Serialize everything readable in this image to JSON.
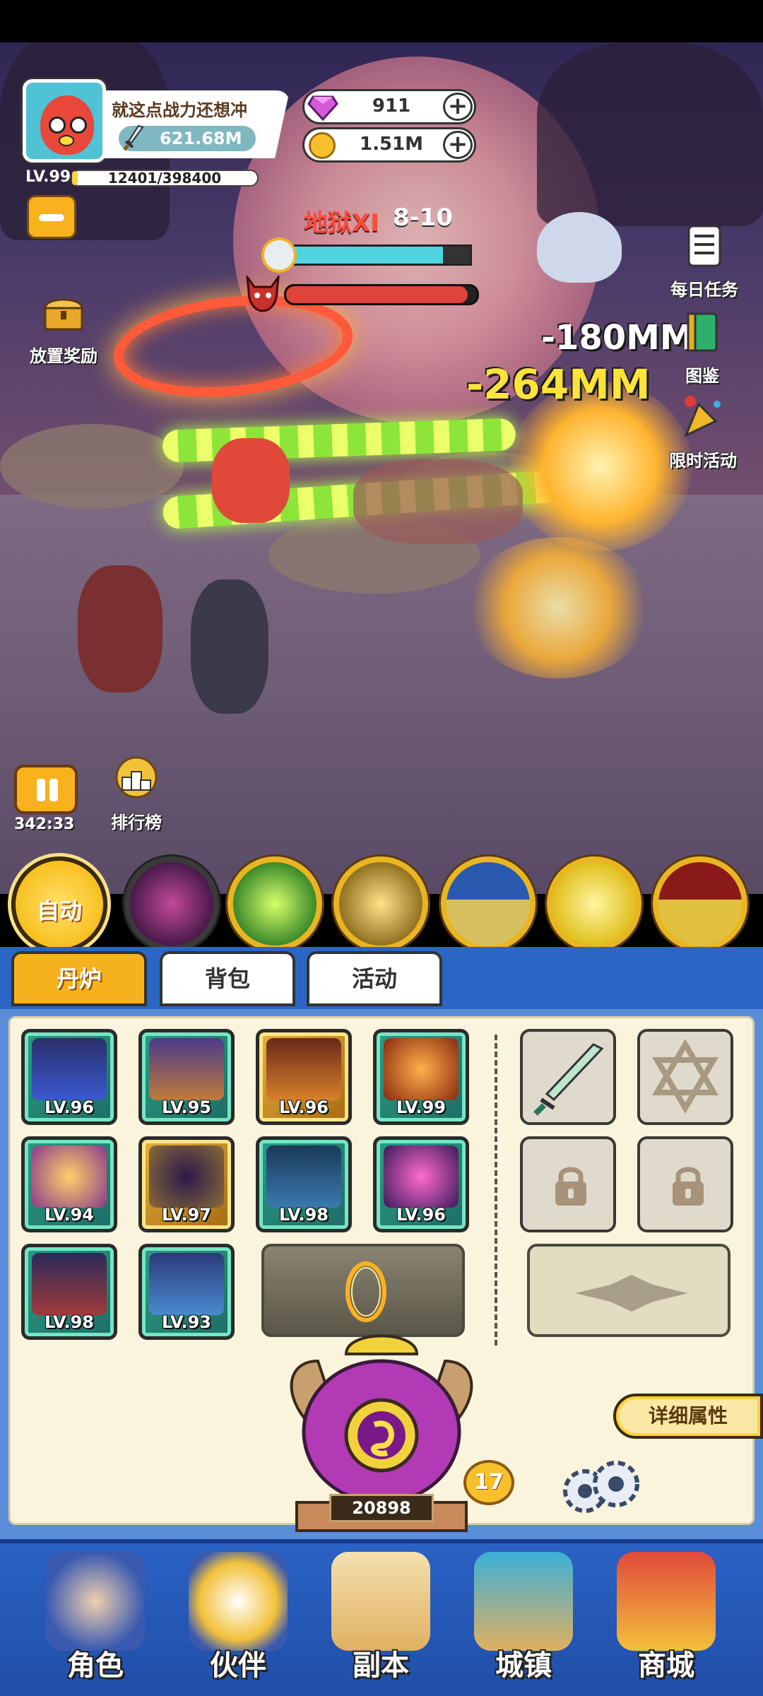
{
  "player": {
    "name": "就这点战力还想冲",
    "power": "621.68M",
    "level": "LV.99",
    "exp_text": "12401/398400",
    "exp_fraction": 0.031
  },
  "currency": {
    "gems": "911",
    "coins": "1.51M"
  },
  "stage": {
    "name": "地狱XI",
    "number": "8-10",
    "timer_fraction": 0.85,
    "boss_hp_fraction": 0.95
  },
  "damage": {
    "first": "-180MM",
    "second": "-264MM"
  },
  "left_features": {
    "idle_reward": "放置奖励",
    "ranking": "排行榜",
    "battle_time": "342:33"
  },
  "right_features": {
    "daily_tasks": "每日任务",
    "codex": "图鉴",
    "limited_event": "限时活动"
  },
  "skills": {
    "auto_label": "自动"
  },
  "tabs": [
    {
      "label": "丹炉",
      "active": true
    },
    {
      "label": "背包",
      "active": false
    },
    {
      "label": "活动",
      "active": false
    }
  ],
  "equipment": [
    {
      "level": "LV.96",
      "icon": "trident-icon",
      "rarity": "green"
    },
    {
      "level": "LV.95",
      "icon": "crown-icon",
      "rarity": "green"
    },
    {
      "level": "LV.96",
      "icon": "armor-icon",
      "rarity": "gold"
    },
    {
      "level": "LV.99",
      "icon": "wolf-orb-icon",
      "rarity": "green"
    },
    {
      "level": "LV.94",
      "icon": "lotus-orb-icon",
      "rarity": "green"
    },
    {
      "level": "LV.97",
      "icon": "dark-orb-icon",
      "rarity": "gold"
    },
    {
      "level": "LV.98",
      "icon": "amulet-icon",
      "rarity": "green"
    },
    {
      "level": "LV.96",
      "icon": "flame-orb-icon",
      "rarity": "green"
    },
    {
      "level": "LV.98",
      "icon": "belt-icon",
      "rarity": "green"
    },
    {
      "level": "LV.93",
      "icon": "boots-icon",
      "rarity": "green"
    }
  ],
  "furnace": {
    "count": "20898",
    "level": "17",
    "detail_label": "详细属性"
  },
  "bottom_nav": [
    {
      "label": "角色",
      "icon": "character-icon"
    },
    {
      "label": "伙伴",
      "icon": "partner-icon"
    },
    {
      "label": "副本",
      "icon": "dungeon-icon"
    },
    {
      "label": "城镇",
      "icon": "town-icon"
    },
    {
      "label": "商城",
      "icon": "shop-icon"
    }
  ],
  "colors": {
    "accent_gold": "#f6b21e",
    "panel_blue": "#2b66c4",
    "rarity_green": "#2a9c82",
    "rarity_gold": "#e6b13a",
    "boss_red": "#e0433a",
    "timer_cyan": "#4fd3df"
  }
}
